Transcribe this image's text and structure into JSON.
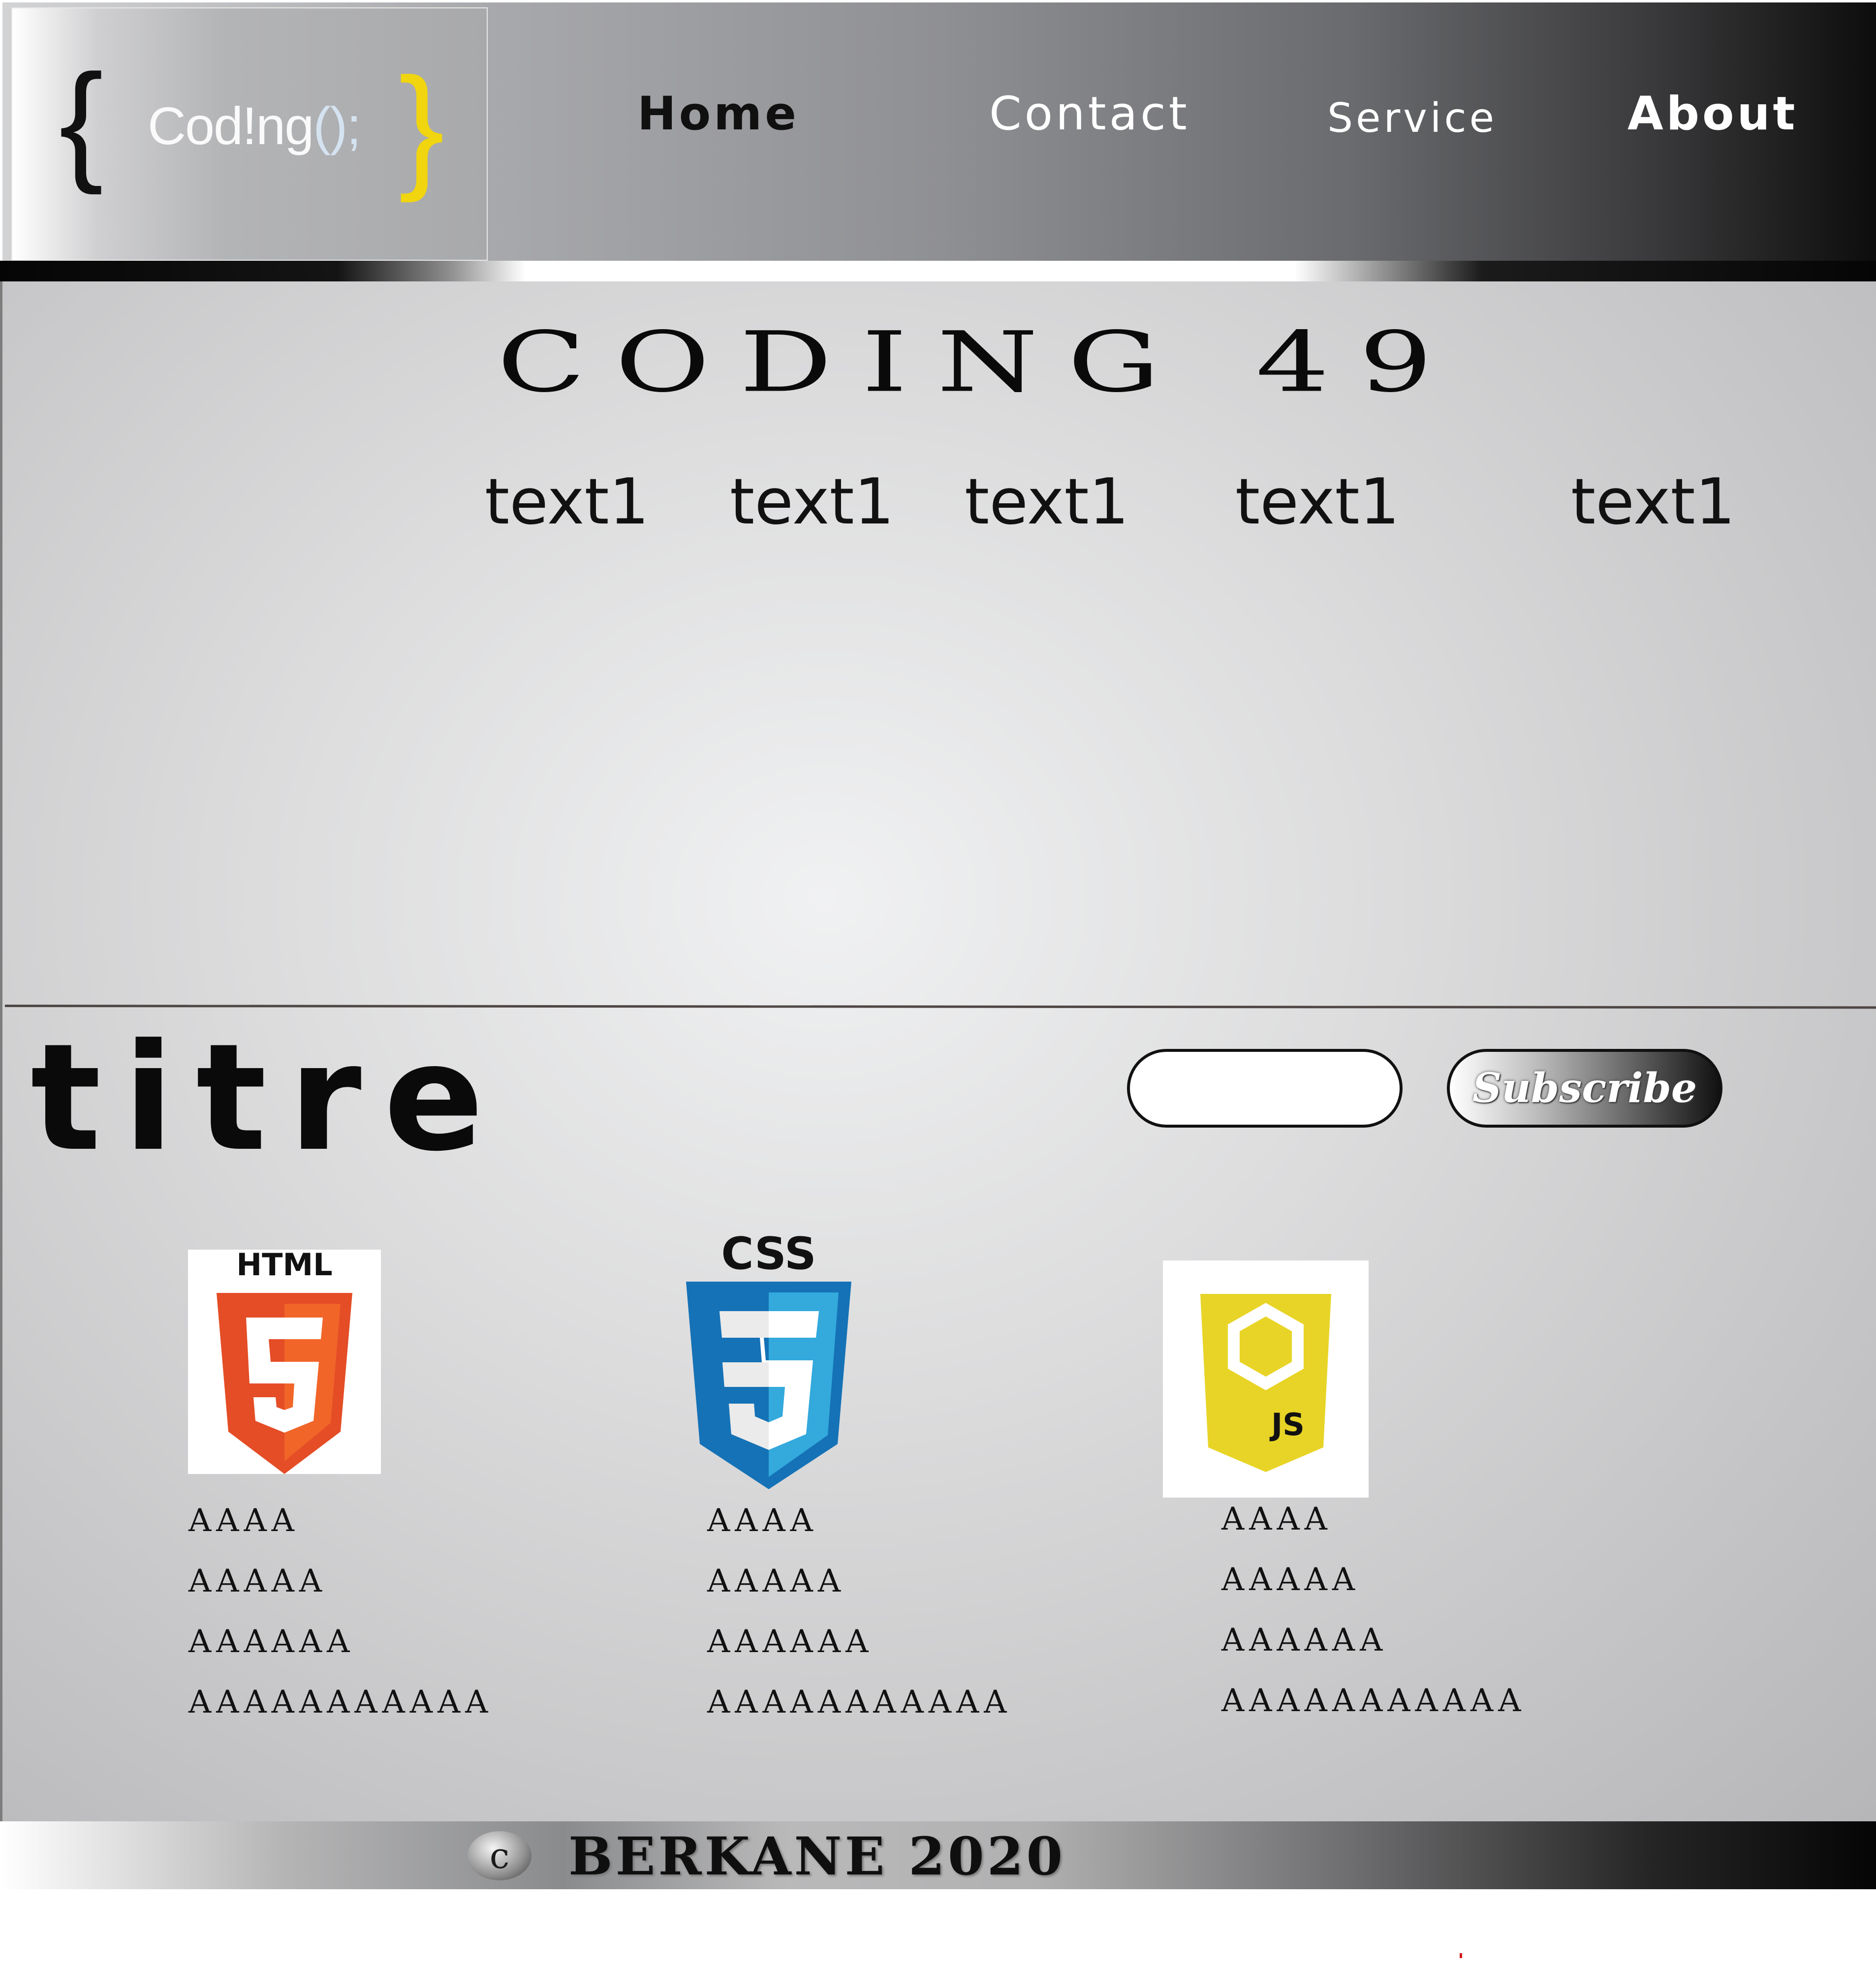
{
  "header": {
    "logo": {
      "brace_open": "{",
      "text_main": "Cod!ng",
      "text_parens": "();",
      "brace_close": "}"
    },
    "nav": [
      {
        "label": "Home"
      },
      {
        "label": "Contact"
      },
      {
        "label": "Service"
      },
      {
        "label": "About"
      }
    ]
  },
  "hero": {
    "title": "CODING 49",
    "items": [
      "text1",
      "text1",
      "text1",
      "text1",
      "text1"
    ]
  },
  "section": {
    "title": "titre",
    "subscribe": {
      "input_value": "",
      "button_label": "Subscribe"
    }
  },
  "technologies": [
    {
      "name": "HTML",
      "badge": "5",
      "items": [
        "AAAA",
        "AAAAA",
        "AAAAAA",
        "AAAAAAAAAAA"
      ]
    },
    {
      "name": "CSS",
      "badge": "3",
      "items": [
        "AAAA",
        "AAAAA",
        "AAAAAA",
        "AAAAAAAAAAA"
      ]
    },
    {
      "name": "JS",
      "badge": "JS",
      "items": [
        "AAAA",
        "AAAAA",
        "AAAAAA",
        "AAAAAAAAAAA"
      ]
    }
  ],
  "footer": {
    "copyright_symbol": "c",
    "text": "BERKANE 2020"
  },
  "colors": {
    "html_orange": "#e44d26",
    "html_orange_light": "#f16529",
    "css_blue_dark": "#1572b6",
    "css_blue_light": "#33a9dc",
    "js_yellow": "#e8d426",
    "logo_brace_yellow": "#f0d50f"
  }
}
